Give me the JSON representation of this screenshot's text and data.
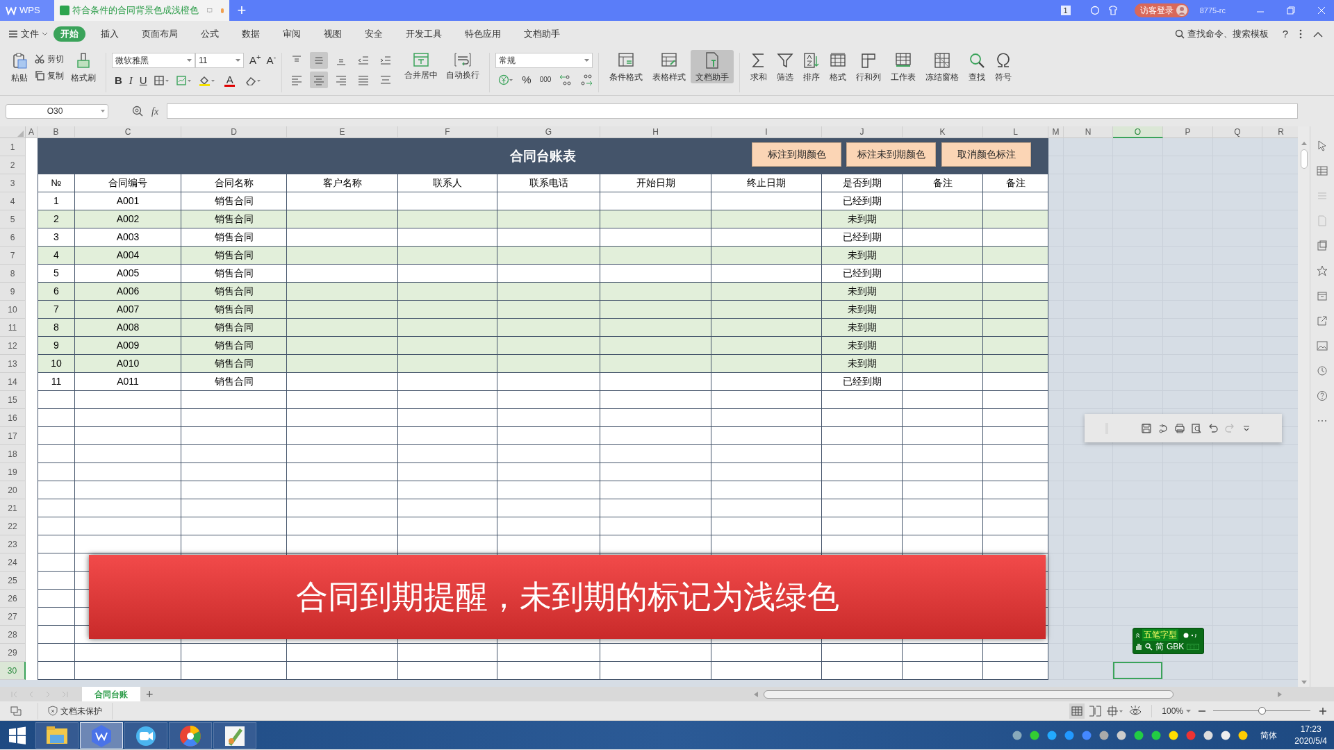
{
  "title_bar": {
    "app_tab": "WPS",
    "doc_tab": {
      "title": "符合条件的合同背景色成浅橙色",
      "modified": true
    },
    "new_tab": "+",
    "badge": "1",
    "login": "访客登录",
    "user": "8775-rc"
  },
  "menu": {
    "file": "文件",
    "tabs": [
      {
        "label": "开始",
        "selected": true
      },
      {
        "label": "插入",
        "selected": false
      },
      {
        "label": "页面布局",
        "selected": false
      },
      {
        "label": "公式",
        "selected": false
      },
      {
        "label": "数据",
        "selected": false
      },
      {
        "label": "审阅",
        "selected": false
      },
      {
        "label": "视图",
        "selected": false
      },
      {
        "label": "安全",
        "selected": false
      },
      {
        "label": "开发工具",
        "selected": false
      },
      {
        "label": "特色应用",
        "selected": false
      },
      {
        "label": "文档助手",
        "selected": false
      }
    ],
    "search": "查找命令、搜索模板",
    "help": "?"
  },
  "ribbon": {
    "paste": "粘贴",
    "cut": "剪切",
    "copy": "复制",
    "format_painter": "格式刷",
    "font": "微软雅黑",
    "font_size": "11",
    "grow": "A$^{+}$",
    "shrink": "A$^{-}$",
    "styles": [
      "B",
      "I",
      "U"
    ],
    "font_color": "A",
    "merge": "合并居中",
    "wrap": "自动换行",
    "number_format": "常规",
    "number_symbols": [
      "%",
      "000"
    ],
    "tools": [
      {
        "label": "条件格式",
        "selected": false
      },
      {
        "label": "表格样式",
        "selected": false
      },
      {
        "label": "文档助手",
        "selected": true
      },
      {
        "label": "求和",
        "selected": false
      },
      {
        "label": "筛选",
        "selected": false
      },
      {
        "label": "排序",
        "selected": false
      },
      {
        "label": "格式",
        "selected": false
      },
      {
        "label": "行和列",
        "selected": false
      },
      {
        "label": "工作表",
        "selected": false
      },
      {
        "label": "冻结窗格",
        "selected": false
      },
      {
        "label": "查找",
        "selected": false
      },
      {
        "label": "符号",
        "selected": false
      }
    ]
  },
  "formula_bar": {
    "name_box": "O30",
    "fx": "fx"
  },
  "sheet": {
    "columns": [
      {
        "label": "A",
        "selected": false
      },
      {
        "label": "B",
        "selected": false
      },
      {
        "label": "C",
        "selected": false
      },
      {
        "label": "D",
        "selected": false
      },
      {
        "label": "E",
        "selected": false
      },
      {
        "label": "F",
        "selected": false
      },
      {
        "label": "G",
        "selected": false
      },
      {
        "label": "H",
        "selected": false
      },
      {
        "label": "I",
        "selected": false
      },
      {
        "label": "J",
        "selected": false
      },
      {
        "label": "K",
        "selected": false
      },
      {
        "label": "L",
        "selected": false
      },
      {
        "label": "M",
        "selected": false
      },
      {
        "label": "N",
        "selected": false
      },
      {
        "label": "O",
        "selected": true
      },
      {
        "label": "P",
        "selected": false
      },
      {
        "label": "Q",
        "selected": false
      },
      {
        "label": "R",
        "selected": false
      }
    ],
    "row_numbers": [
      {
        "label": "1",
        "selected": false
      },
      {
        "label": "2",
        "selected": false
      },
      {
        "label": "3",
        "selected": false
      },
      {
        "label": "4",
        "selected": false
      },
      {
        "label": "5",
        "selected": false
      },
      {
        "label": "6",
        "selected": false
      },
      {
        "label": "7",
        "selected": false
      },
      {
        "label": "8",
        "selected": false
      },
      {
        "label": "9",
        "selected": false
      },
      {
        "label": "10",
        "selected": false
      },
      {
        "label": "11",
        "selected": false
      },
      {
        "label": "12",
        "selected": false
      },
      {
        "label": "13",
        "selected": false
      },
      {
        "label": "14",
        "selected": false
      },
      {
        "label": "15",
        "selected": false
      },
      {
        "label": "16",
        "selected": false
      },
      {
        "label": "17",
        "selected": false
      },
      {
        "label": "18",
        "selected": false
      },
      {
        "label": "19",
        "selected": false
      },
      {
        "label": "20",
        "selected": false
      },
      {
        "label": "21",
        "selected": false
      },
      {
        "label": "22",
        "selected": false
      },
      {
        "label": "23",
        "selected": false
      },
      {
        "label": "24",
        "selected": false
      },
      {
        "label": "25",
        "selected": false
      },
      {
        "label": "26",
        "selected": false
      },
      {
        "label": "27",
        "selected": false
      },
      {
        "label": "28",
        "selected": false
      },
      {
        "label": "29",
        "selected": false
      },
      {
        "label": "30",
        "selected": true
      }
    ],
    "title": "合同台账表",
    "buttons": [
      "标注到期颜色",
      "标注未到期颜色",
      "取消颜色标注"
    ],
    "headers": [
      "№",
      "合同编号",
      "合同名称",
      "客户名称",
      "联系人",
      "联系电话",
      "开始日期",
      "终止日期",
      "是否到期",
      "备注",
      "备注"
    ],
    "records": [
      {
        "no": "1",
        "code": "A001",
        "name": "销售合同",
        "status": "已经到期",
        "highlighted": false
      },
      {
        "no": "2",
        "code": "A002",
        "name": "销售合同",
        "status": "未到期",
        "highlighted": true
      },
      {
        "no": "3",
        "code": "A003",
        "name": "销售合同",
        "status": "已经到期",
        "highlighted": false
      },
      {
        "no": "4",
        "code": "A004",
        "name": "销售合同",
        "status": "未到期",
        "highlighted": true
      },
      {
        "no": "5",
        "code": "A005",
        "name": "销售合同",
        "status": "已经到期",
        "highlighted": false
      },
      {
        "no": "6",
        "code": "A006",
        "name": "销售合同",
        "status": "未到期",
        "highlighted": true
      },
      {
        "no": "7",
        "code": "A007",
        "name": "销售合同",
        "status": "未到期",
        "highlighted": true
      },
      {
        "no": "8",
        "code": "A008",
        "name": "销售合同",
        "status": "未到期",
        "highlighted": true
      },
      {
        "no": "9",
        "code": "A009",
        "name": "销售合同",
        "status": "未到期",
        "highlighted": true
      },
      {
        "no": "10",
        "code": "A010",
        "name": "销售合同",
        "status": "未到期",
        "highlighted": true
      },
      {
        "no": "11",
        "code": "A011",
        "name": "销售合同",
        "status": "已经到期",
        "highlighted": false
      }
    ],
    "banner": "合同到期提醒，未到期的标记为浅绿色"
  },
  "ime": {
    "mode": "五笔字型",
    "script": "简",
    "charset": "GBK"
  },
  "sheet_tabs": [
    {
      "label": "合同台账",
      "selected": true
    }
  ],
  "new_sheet": "+",
  "status_bar": {
    "protection": "文档未保护",
    "zoom": "100%",
    "zoom_slider": {
      "level": 0.5
    }
  },
  "taskbar": {
    "ime": "简体",
    "time": "17:23",
    "date": "2020/5/4"
  }
}
